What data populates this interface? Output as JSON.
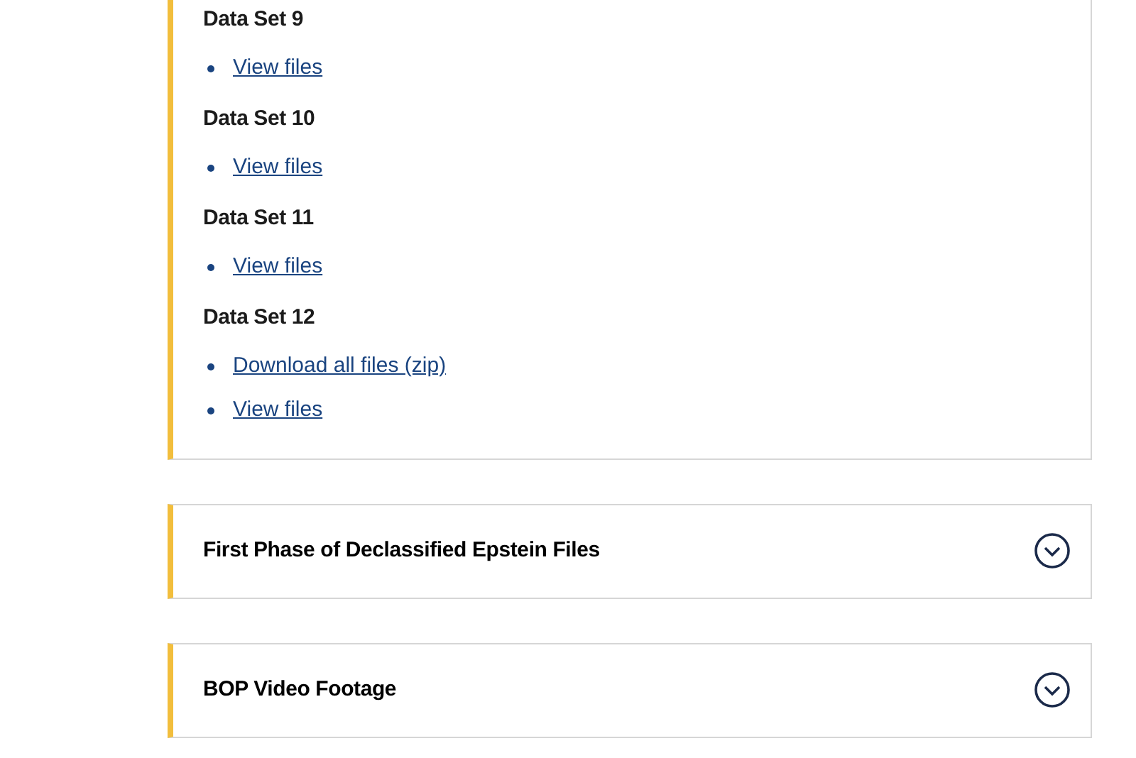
{
  "accordion": [
    {
      "kind": "open",
      "expanded": true,
      "data_sets": [
        {
          "heading": "Data Set 9",
          "links": [
            "View files"
          ]
        },
        {
          "heading": "Data Set 10",
          "links": [
            "View files"
          ]
        },
        {
          "heading": "Data Set 11",
          "links": [
            "View files"
          ]
        },
        {
          "heading": "Data Set 12",
          "links": [
            "Download all files (zip)",
            "View files"
          ]
        }
      ]
    },
    {
      "kind": "closed",
      "title": "First Phase of Declassified Epstein Files",
      "expanded": false
    },
    {
      "kind": "closed",
      "title": "BOP Video Footage",
      "expanded": false
    }
  ]
}
